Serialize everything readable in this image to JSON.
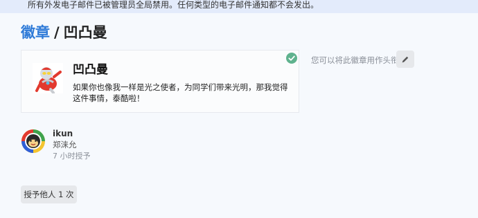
{
  "notice": {
    "text": "所有外发电子邮件已被管理员全局禁用。任何类型的电子邮件通知都不会发出。"
  },
  "breadcrumb": {
    "parent": "徽章",
    "separator": "/",
    "current": "凹凸曼"
  },
  "badge": {
    "title": "凹凸曼",
    "description": "如果你也像我一样是光之使者，为同学们带来光明，那我觉得这件事情，泰酷啦！",
    "icon": "ultraman-badge-image",
    "granted_icon": "check-circle-icon"
  },
  "sidebar": {
    "title_hint": "您可以将此徽章用作头衔",
    "edit_icon": "pencil-icon"
  },
  "grantee": {
    "username": "ikun",
    "full_name": "郑涞允",
    "granted": "7 小时授予"
  },
  "grant_button": {
    "label": "授予他人 1 次"
  },
  "colors": {
    "link": "#2f7bd8",
    "notice_bg": "#e3ebfb",
    "check": "#5fb28e",
    "button_bg": "#e6e8eb"
  }
}
